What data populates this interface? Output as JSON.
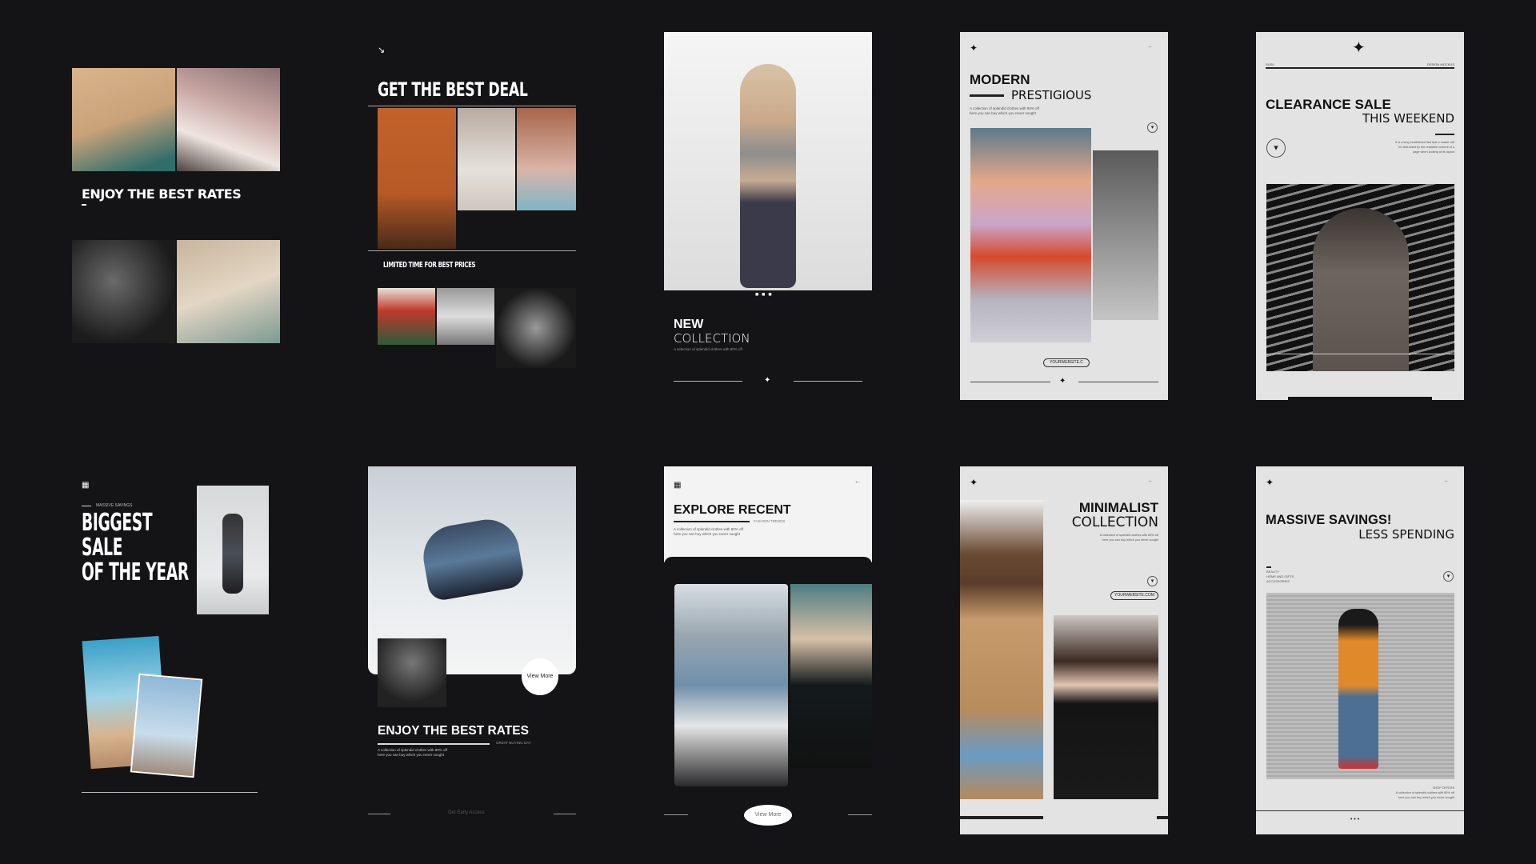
{
  "canvas": {
    "background": "#141416"
  },
  "cards": {
    "c1": {
      "title": "ENJOY THE BEST RATES",
      "photos": [
        "woman-white-shirt",
        "woman-white-dress",
        "dancer-dark",
        "woman-sunglasses"
      ]
    },
    "c2": {
      "corner_icon": "↘",
      "title": "GET THE BEST DEAL",
      "subtitle": "LIMITED TIME FOR BEST PRICES"
    },
    "c3": {
      "dots": "■ ■ ■",
      "title_bold": "NEW",
      "title_light": "COLLECTION",
      "desc": "A selection of splendid clothes with 80% off",
      "divider_icon": "✦"
    },
    "c4": {
      "star": "✦",
      "arrow": "←",
      "title_bold": "MODERN",
      "title_light": "PRESTIGIOUS",
      "desc1": "A collection of splendid clothes with 80% off",
      "desc2": "here you can buy which you never sought",
      "chevron": "▾",
      "website": "YOURWEBSITE.C",
      "divider_icon": "✦"
    },
    "c5": {
      "star": "✦",
      "left_label": "SUSU",
      "right_label": "DESIGN MOCKUS",
      "title_bold": "CLEARANCE SALE",
      "title_light": "THIS WEEKEND",
      "desc1": "It is a long established fact that a reader will",
      "desc2": "be distracted by the readable content of a",
      "desc3": "page when looking at its layout",
      "chevron": "▾"
    },
    "c6": {
      "grid_icon": "▦",
      "kicker": "MASSIVE SAVINGS",
      "title_lines": [
        "BIGGEST",
        "SALE",
        "OF THE YEAR"
      ]
    },
    "c7": {
      "view_more": "View More",
      "title": "ENJOY THE BEST RATES",
      "tagline": "GREAT BUYING DAY",
      "desc1": "A collection of splendid clothes with 80% off",
      "desc2": "here you can buy which you never sought",
      "footer": "Get Early Access"
    },
    "c8": {
      "grid_icon": "▦",
      "arrow": "←",
      "title": "EXPLORE RECENT",
      "tagline": "FASHION TRENDS",
      "desc1": "A collection of splendid clothes with 80% off",
      "desc2": "here you can buy which you never sought",
      "view_more": "View More"
    },
    "c9": {
      "star": "✦",
      "arrow": "←",
      "title_bold": "MINIMALIST",
      "title_light": "COLLECTION",
      "desc1": "A collection of splendid clothes with 80% off",
      "desc2": "here you can buy which you never sought",
      "chevron": "▾",
      "website": "YOURWEBSITE.COM"
    },
    "c10": {
      "star": "✦",
      "arrow": "←",
      "title_bold": "MASSIVE SAVINGS!",
      "title_light": "LESS SPENDING",
      "categories": [
        "BEAUTY",
        "HOME AND GIFTS",
        "ACCESSORIES"
      ],
      "chevron": "▾",
      "shop_label": "SHOP OFFERS",
      "desc1": "A collection of splendid clothes with 80% off",
      "desc2": "here you can buy which you never sought",
      "dots": "• • •"
    }
  }
}
